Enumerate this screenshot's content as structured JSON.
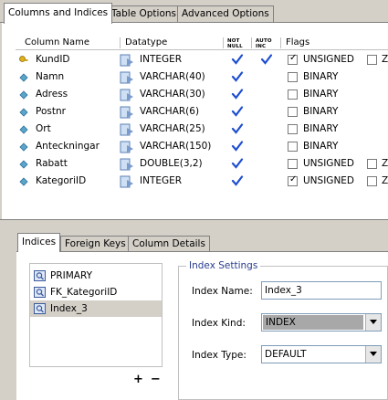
{
  "tabs": [
    "Columns and Indices",
    "Table Options",
    "Advanced Options"
  ],
  "grid_headers": {
    "name": "Column Name",
    "type": "Datatype",
    "notnull": "NOT NULL",
    "autoinc": "AUTO INC",
    "flags": "Flags"
  },
  "columns": [
    {
      "name": "KundID",
      "type": "INTEGER",
      "notnull": true,
      "autoinc": true,
      "flag": "UNSIGNED",
      "flag_checked": true,
      "extra": "Z"
    },
    {
      "name": "Namn",
      "type": "VARCHAR(40)",
      "notnull": true,
      "autoinc": false,
      "flag": "BINARY",
      "flag_checked": false,
      "extra": ""
    },
    {
      "name": "Adress",
      "type": "VARCHAR(30)",
      "notnull": true,
      "autoinc": false,
      "flag": "BINARY",
      "flag_checked": false,
      "extra": ""
    },
    {
      "name": "Postnr",
      "type": "VARCHAR(6)",
      "notnull": true,
      "autoinc": false,
      "flag": "BINARY",
      "flag_checked": false,
      "extra": ""
    },
    {
      "name": "Ort",
      "type": "VARCHAR(25)",
      "notnull": true,
      "autoinc": false,
      "flag": "BINARY",
      "flag_checked": false,
      "extra": ""
    },
    {
      "name": "Anteckningar",
      "type": "VARCHAR(150)",
      "notnull": true,
      "autoinc": false,
      "flag": "BINARY",
      "flag_checked": false,
      "extra": ""
    },
    {
      "name": "Rabatt",
      "type": "DOUBLE(3,2)",
      "notnull": true,
      "autoinc": false,
      "flag": "UNSIGNED",
      "flag_checked": false,
      "extra": "Z"
    },
    {
      "name": "KategoriID",
      "type": "INTEGER",
      "notnull": true,
      "autoinc": false,
      "flag": "UNSIGNED",
      "flag_checked": true,
      "extra": "Z"
    }
  ],
  "subtabs": [
    "Indices",
    "Foreign Keys",
    "Column Details"
  ],
  "indices": [
    "PRIMARY",
    "FK_KategoriID",
    "Index_3"
  ],
  "selected_index": "Index_3",
  "list_buttons": {
    "add": "+",
    "remove": "−"
  },
  "index_settings": {
    "title": "Index Settings",
    "name_label": "Index Name:",
    "name_value": "Index_3",
    "kind_label": "Index Kind:",
    "kind_value": "INDEX",
    "type_label": "Index Type:",
    "type_value": "DEFAULT"
  },
  "colors": {
    "check_blue": "#1f4fd1",
    "group_title": "#2a3d8f"
  }
}
